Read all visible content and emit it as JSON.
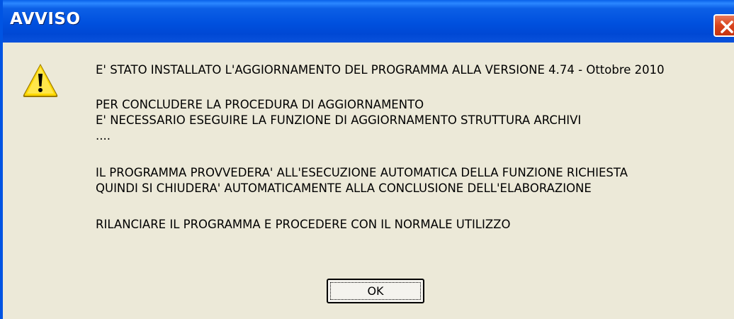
{
  "dialog": {
    "title": "AVVISO",
    "icon": "warning-icon",
    "message_lines": [
      "E' STATO INSTALLATO L'AGGIORNAMENTO DEL PROGRAMMA ALLA VERSIONE 4.74 - Ottobre 2010",
      "PER CONCLUDERE LA PROCEDURA DI AGGIORNAMENTO",
      "E' NECESSARIO ESEGUIRE LA FUNZIONE DI AGGIORNAMENTO STRUTTURA ARCHIVI",
      "....",
      "IL PROGRAMMA PROVVEDERA' ALL'ESECUZIONE AUTOMATICA DELLA FUNZIONE RICHIESTA",
      "QUINDI SI CHIUDERA' AUTOMATICAMENTE ALLA CONCLUSIONE DELL'ELABORAZIONE",
      "RILANCIARE IL PROGRAMMA E PROCEDERE CON IL NORMALE UTILIZZO"
    ],
    "ok_label": "OK"
  },
  "colors": {
    "titlebar": "#0054e3",
    "close_button": "#d9431c",
    "dialog_background": "#ece9d8",
    "warning_yellow": "#ffd800"
  }
}
